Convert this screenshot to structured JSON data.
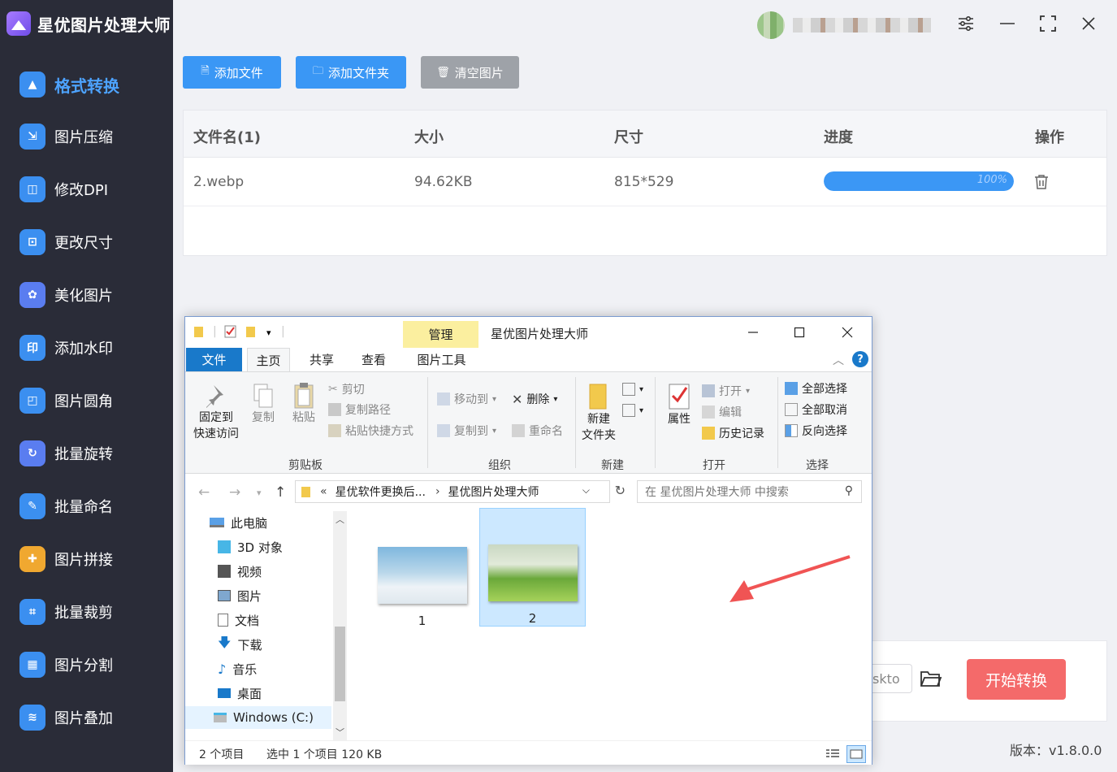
{
  "app": {
    "title": "星优图片处理大师",
    "version": "版本：v1.8.0.0"
  },
  "sidebar": {
    "items": [
      {
        "label": "格式转换",
        "icon": "image-convert-icon",
        "color": "#3b8ff0",
        "glyph": "▲",
        "active": true
      },
      {
        "label": "图片压缩",
        "icon": "image-compress-icon",
        "color": "#3b8ff0",
        "glyph": "⇲"
      },
      {
        "label": "修改DPI",
        "icon": "dpi-icon",
        "color": "#3b8ff0",
        "glyph": "◫"
      },
      {
        "label": "更改尺寸",
        "icon": "resize-icon",
        "color": "#3b8ff0",
        "glyph": "⊡"
      },
      {
        "label": "美化图片",
        "icon": "beautify-icon",
        "color": "#5a7df0",
        "glyph": "✿"
      },
      {
        "label": "添加水印",
        "icon": "watermark-icon",
        "color": "#3b8ff0",
        "glyph": "印"
      },
      {
        "label": "图片圆角",
        "icon": "round-corner-icon",
        "color": "#3b8ff0",
        "glyph": "◰"
      },
      {
        "label": "批量旋转",
        "icon": "rotate-icon",
        "color": "#5a7df0",
        "glyph": "↻"
      },
      {
        "label": "批量命名",
        "icon": "rename-icon",
        "color": "#3b8ff0",
        "glyph": "✎"
      },
      {
        "label": "图片拼接",
        "icon": "puzzle-icon",
        "color": "#f0a830",
        "glyph": "✚"
      },
      {
        "label": "批量裁剪",
        "icon": "crop-icon",
        "color": "#3b8ff0",
        "glyph": "⌗"
      },
      {
        "label": "图片分割",
        "icon": "split-icon",
        "color": "#3b8ff0",
        "glyph": "▦"
      },
      {
        "label": "图片叠加",
        "icon": "layers-icon",
        "color": "#3b8ff0",
        "glyph": "≋"
      }
    ]
  },
  "toolbar": {
    "add_file": "添加文件",
    "add_folder": "添加文件夹",
    "clear": "清空图片",
    "add_color": "#3a97f5",
    "clear_color": "#9ea2a8"
  },
  "table": {
    "headers": [
      "文件名(1)",
      "大小",
      "尺寸",
      "进度",
      "操作"
    ],
    "rows": [
      {
        "name": "2.webp",
        "size": "94.62KB",
        "dimensions": "815*529",
        "progress_text": "100%",
        "progress": 100
      }
    ]
  },
  "output": {
    "path_value": "skto",
    "start_button": "开始转换",
    "start_color": "#f46a6a"
  },
  "explorer": {
    "title": "星优图片处理大师",
    "manage_tab": "管理",
    "tabs": [
      "文件",
      "主页",
      "共享",
      "查看",
      "图片工具"
    ],
    "ribbon": {
      "pin": "固定到\n快速访问",
      "pin_l1": "固定到",
      "pin_l2": "快速访问",
      "copy": "复制",
      "paste": "粘贴",
      "cut": "剪切",
      "copy_path": "复制路径",
      "paste_shortcut": "粘贴快捷方式",
      "clipboard_group": "剪贴板",
      "move_to": "移动到",
      "copy_to": "复制到",
      "delete": "删除",
      "rename": "重命名",
      "organize_group": "组织",
      "new_folder_l1": "新建",
      "new_folder_l2": "文件夹",
      "new_group": "新建",
      "properties": "属性",
      "open": "打开",
      "edit": "编辑",
      "history": "历史记录",
      "open_group": "打开",
      "select_all": "全部选择",
      "select_none": "全部取消",
      "invert_select": "反向选择",
      "select_group": "选择"
    },
    "address": {
      "prefix": "«",
      "crumb1": "星优软件更换后...",
      "sep": "›",
      "crumb2": "星优图片处理大师"
    },
    "search_placeholder": "在 星优图片处理大师 中搜索",
    "tree": [
      "此电脑",
      "3D 对象",
      "视频",
      "图片",
      "文档",
      "下载",
      "音乐",
      "桌面",
      "Windows (C:)"
    ],
    "files": [
      {
        "name": "1",
        "selected": false
      },
      {
        "name": "2",
        "selected": true
      }
    ],
    "status_count": "2 个项目",
    "status_selected": "选中 1 个项目  120 KB"
  }
}
